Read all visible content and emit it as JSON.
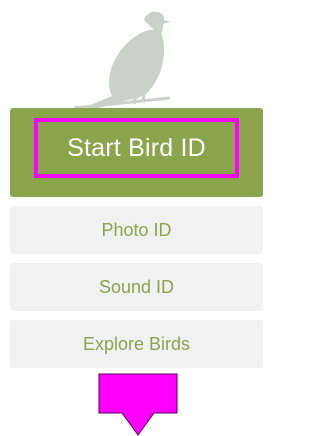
{
  "theme": {
    "accent_color": "#8aa54b",
    "annotation_color": "#ff00ff",
    "bird_color": "#c9d1c9"
  },
  "hero": {
    "icon": "perched-bird-icon"
  },
  "menu": {
    "start_label": "Start Bird ID",
    "photo_label": "Photo ID",
    "sound_label": "Sound ID",
    "explore_label": "Explore Birds"
  },
  "annotation": {
    "highlight": "highlight-box",
    "arrow_icon": "down-arrow-icon"
  }
}
